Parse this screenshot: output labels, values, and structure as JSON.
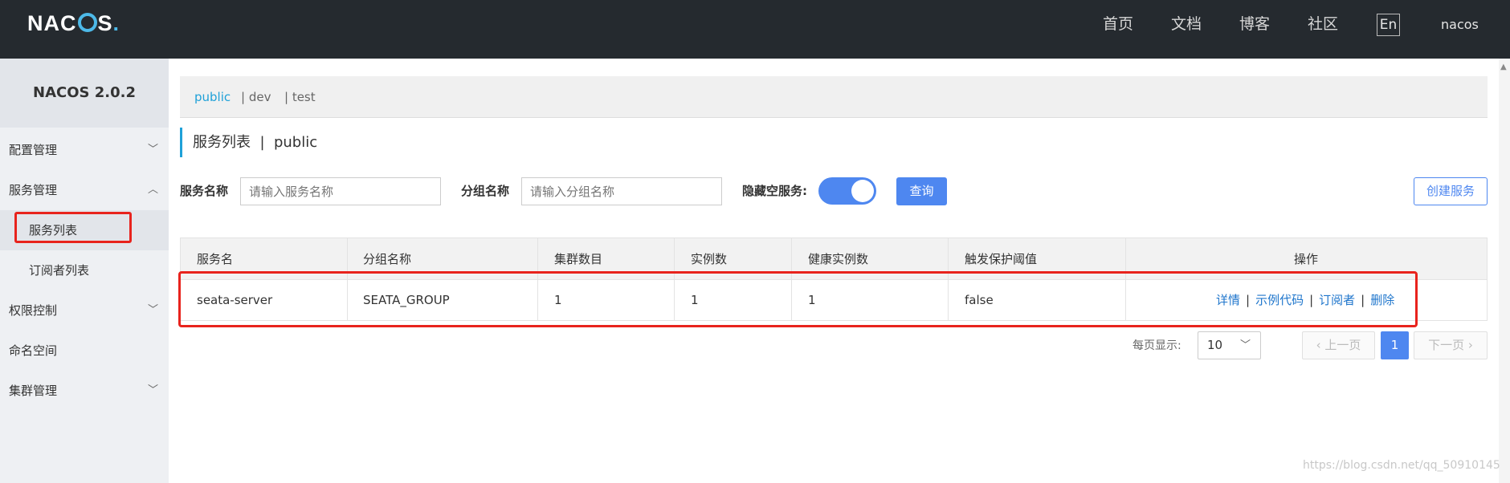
{
  "header": {
    "logo": {
      "pre": "NA",
      "mid": "C",
      "post": "S",
      "dot": "."
    },
    "nav": [
      "首页",
      "文档",
      "博客",
      "社区"
    ],
    "lang": "En",
    "user": "nacos"
  },
  "sidebar": {
    "version": "NACOS 2.0.2",
    "items": [
      {
        "label": "配置管理",
        "caret": "﹀"
      },
      {
        "label": "服务管理",
        "caret": "︿"
      },
      {
        "label": "服务列表"
      },
      {
        "label": "订阅者列表"
      },
      {
        "label": "权限控制",
        "caret": "﹀"
      },
      {
        "label": "命名空间"
      },
      {
        "label": "集群管理",
        "caret": "﹀"
      }
    ]
  },
  "namespaces": {
    "current": "public",
    "others": [
      "| dev",
      "| test"
    ]
  },
  "page": {
    "title": "服务列表  |  public"
  },
  "filters": {
    "service_label": "服务名称",
    "service_placeholder": "请输入服务名称",
    "group_label": "分组名称",
    "group_placeholder": "请输入分组名称",
    "hide_empty_label": "隐藏空服务:",
    "hide_empty_on": true,
    "query_button": "查询",
    "create_button": "创建服务"
  },
  "table": {
    "headers": [
      "服务名",
      "分组名称",
      "集群数目",
      "实例数",
      "健康实例数",
      "触发保护阈值",
      "操作"
    ],
    "rows": [
      {
        "name": "seata-server",
        "group": "SEATA_GROUP",
        "clusters": "1",
        "instances": "1",
        "healthy": "1",
        "threshold": "false",
        "ops": [
          "详情",
          "示例代码",
          "订阅者",
          "删除"
        ]
      }
    ]
  },
  "pagination": {
    "per_page_label": "每页显示:",
    "per_page": "10",
    "prev": "上一页",
    "current": "1",
    "next": "下一页"
  },
  "watermark": "https://blog.csdn.net/qq_50910145",
  "colors": {
    "accent": "#4e87f0",
    "highlight": "#e8231d",
    "link": "#1f76cc",
    "topbar": "#252a2f"
  }
}
